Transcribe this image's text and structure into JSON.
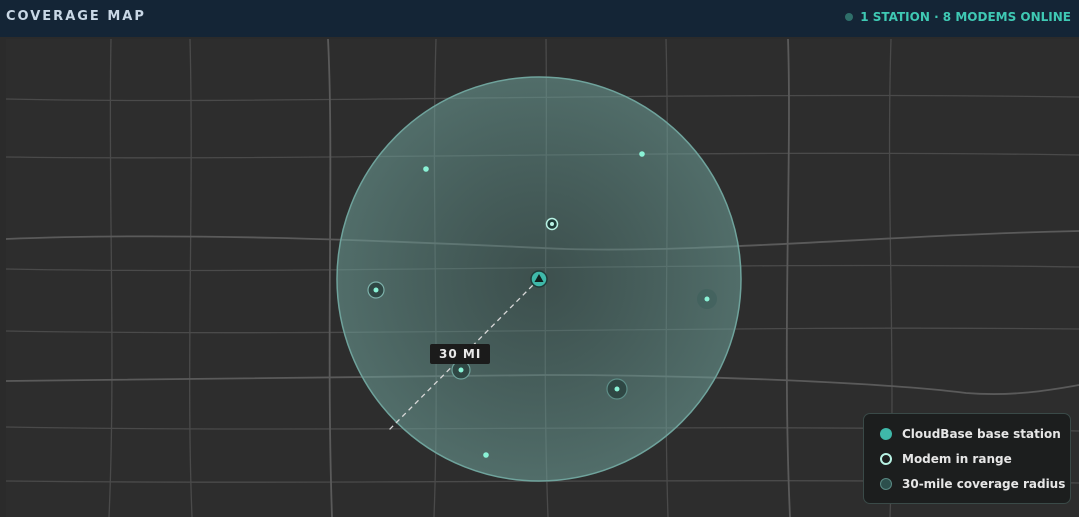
{
  "header": {
    "title": "COVERAGE MAP",
    "status": "1 STATION · 8 MODEMS ONLINE"
  },
  "map": {
    "radius_label": "30 MI",
    "base_station_icon": "triangle-marker-icon",
    "modem_count": 8
  },
  "legend": {
    "items": [
      {
        "label": "CloudBase base station",
        "symbol": "filled-circle-icon"
      },
      {
        "label": "Modem in range",
        "symbol": "ring-circle-icon"
      },
      {
        "label": "30-mile coverage radius",
        "symbol": "shaded-circle-icon"
      }
    ]
  },
  "colors": {
    "header_bg": "#142536",
    "accent": "#3fc9b4",
    "map_bg": "#2d2d2d",
    "coverage_fill": "#4f8a84"
  }
}
